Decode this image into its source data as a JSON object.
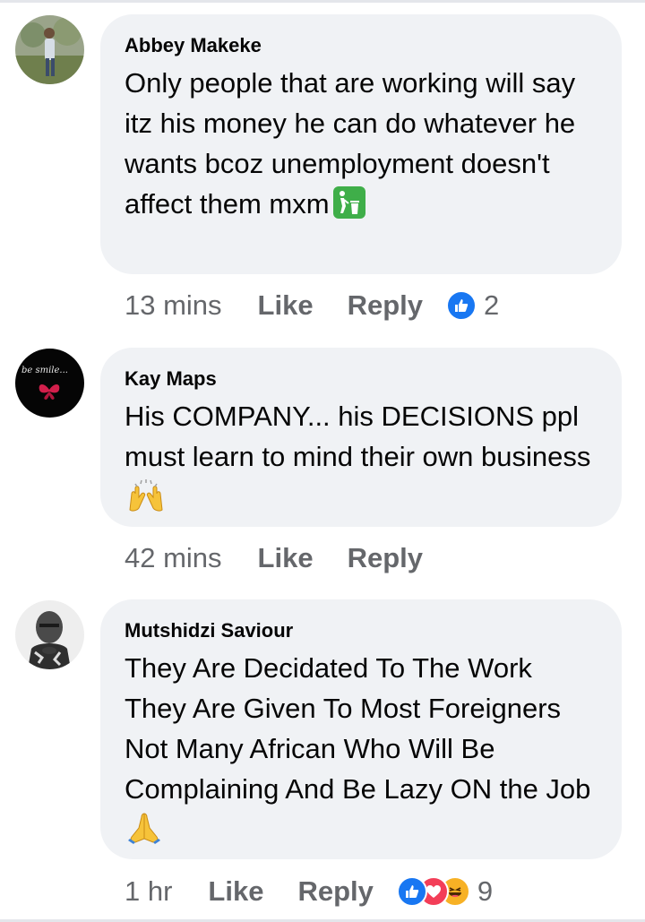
{
  "comments": [
    {
      "author": "Abbey Makeke",
      "text": "Only people that are working will say itz his money he can do whatever he wants bcoz unemployment doesn't affect them mxm",
      "emoji": "trash-bin-emoji",
      "time": "13 mins",
      "like_label": "Like",
      "reply_label": "Reply",
      "reactions": [
        "like"
      ],
      "reaction_count": "2"
    },
    {
      "author": "Kay Maps",
      "avatar_text": "be smile...",
      "text": "His COMPANY... his DECISIONS ppl must learn to mind their own business",
      "emoji": "raising-hands-emoji",
      "time": "42 mins",
      "like_label": "Like",
      "reply_label": "Reply"
    },
    {
      "author": "Mutshidzi Saviour",
      "text": "They Are Decidated To The Work They Are Given To Most Foreigners Not Many African Who Will Be Complaining And Be Lazy ON the Job",
      "emoji": "folded-hands-emoji",
      "time": "1 hr",
      "like_label": "Like",
      "reply_label": "Reply",
      "reactions": [
        "like",
        "love",
        "haha"
      ],
      "reaction_count": "9"
    }
  ],
  "colors": {
    "bubble": "#f0f2f5",
    "meta": "#65676b",
    "like_blue": "#1877f2",
    "love_red": "#f33e58",
    "haha_yellow": "#f7b125"
  }
}
